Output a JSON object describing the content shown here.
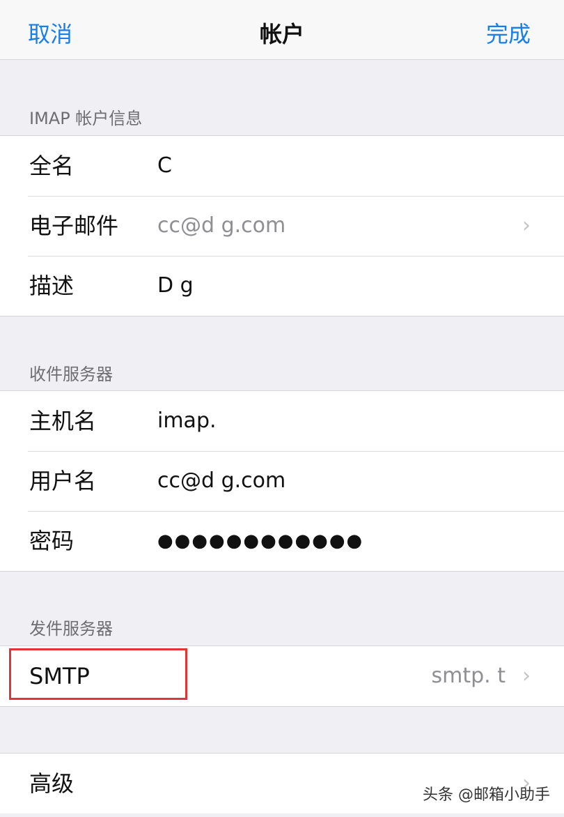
{
  "navbar": {
    "cancel_label": "取消",
    "title": "帐户",
    "done_label": "完成"
  },
  "account_info": {
    "header": "IMAP 帐户信息",
    "rows": [
      {
        "label": "全名",
        "value": "C"
      },
      {
        "label": "电子邮件",
        "value": "cc@d          g.com"
      },
      {
        "label": "描述",
        "value": "D           g"
      }
    ]
  },
  "incoming_server": {
    "header": "收件服务器",
    "rows": [
      {
        "label": "主机名",
        "value": "imap."
      },
      {
        "label": "用户名",
        "value": "cc@d          g.com"
      },
      {
        "label": "密码",
        "value": "●●●●●●●●●●●●"
      }
    ]
  },
  "outgoing_server": {
    "header": "发件服务器",
    "smtp_label": "SMTP",
    "smtp_value": "smtp.          t"
  },
  "advanced": {
    "label": "高级"
  },
  "icons": {
    "chevron": "chevron-right-icon"
  },
  "colors": {
    "accent": "#1a7ee8",
    "highlight_box": "#e0343a",
    "background": "#efeff4"
  },
  "watermark": "头条 @邮箱小助手"
}
